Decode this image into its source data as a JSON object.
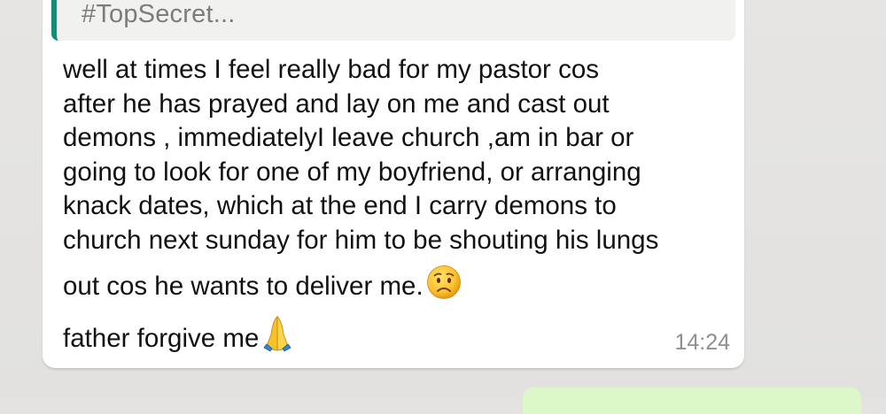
{
  "chat": {
    "quoted_reply": "#TopSecret...",
    "message_lines": [
      "well at times I feel really bad for my pastor cos",
      "after he has prayed and lay on me and cast out",
      "demons , immediatelyI leave church ,am in bar or",
      "going to look for one of my boyfriend, or arranging",
      "knack dates, which at the end I carry demons to",
      "church next sunday for him to be shouting his lungs",
      "out cos he wants to deliver me."
    ],
    "signoff": "father forgive me",
    "timestamp": "14:24",
    "emojis": {
      "after_message": "worried-face-emoji",
      "after_signoff": "folded-hands-emoji"
    }
  },
  "colors": {
    "chat_background": "#e4e3e1",
    "incoming_bubble": "#ffffff",
    "quote_background": "#f1f1f0",
    "quote_accent": "#0e8f7a",
    "outgoing_bubble": "#dcf7c8",
    "timestamp_text": "#8f8f8f"
  }
}
